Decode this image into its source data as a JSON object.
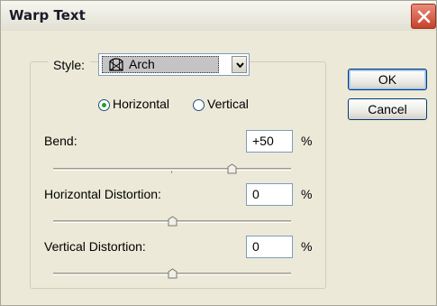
{
  "window": {
    "title": "Warp Text"
  },
  "style": {
    "label": "Style:",
    "value": "Arch",
    "icon": "arch-warp-icon"
  },
  "orientation": {
    "options": [
      "Horizontal",
      "Vertical"
    ],
    "selected": "Horizontal"
  },
  "bend": {
    "label": "Bend:",
    "value": "+50",
    "unit": "%",
    "level": 0.75
  },
  "horizontal_distortion": {
    "label": "Horizontal Distortion:",
    "value": "0",
    "unit": "%",
    "level": 0.5
  },
  "vertical_distortion": {
    "label": "Vertical Distortion:",
    "value": "0",
    "unit": "%",
    "level": 0.5
  },
  "buttons": {
    "ok": "OK",
    "cancel": "Cancel"
  },
  "colors": {
    "title_bar": "#f7f6ef",
    "close_button": "#d25a42",
    "dialog_bg": "#ece9d8",
    "radio_selected": "#21a121"
  }
}
